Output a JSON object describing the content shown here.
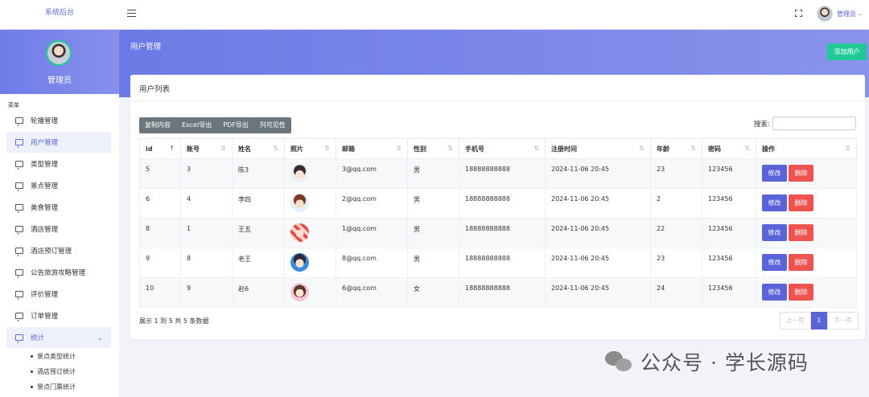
{
  "brand": "系统后台",
  "topbar": {
    "user_name": "管理员",
    "caret": "⌄"
  },
  "sidebar": {
    "user_name": "管理员",
    "menu_caption": "菜单",
    "items": [
      "轮播管理",
      "用户管理",
      "类型管理",
      "景点管理",
      "美食管理",
      "酒店管理",
      "酒店预订管理",
      "公告旅游攻略管理",
      "评价管理",
      "订单管理",
      "统计"
    ],
    "active_index": 1,
    "stats_chevron": "⌄",
    "sub_items": [
      "景点类型统计",
      "酒店预订统计",
      "景点门票统计"
    ]
  },
  "page": {
    "title": "用户管理",
    "add_button": "添加用户"
  },
  "card": {
    "title": "用户列表",
    "tools": [
      "复制内容",
      "Excel导出",
      "PDF导出",
      "列可见性"
    ],
    "search_label": "搜索:",
    "columns": [
      "id",
      "账号",
      "姓名",
      "照片",
      "邮箱",
      "性别",
      "手机号",
      "注册时间",
      "年龄",
      "密码",
      "操作"
    ],
    "rows": [
      {
        "id": "5",
        "account": "3",
        "name": "陈3",
        "email": "3@qq.com",
        "gender": "男",
        "phone": "18888888888",
        "time": "2024-11-06 20:45",
        "age": "23",
        "pwd": "123456"
      },
      {
        "id": "6",
        "account": "4",
        "name": "李四",
        "email": "2@qq.com",
        "gender": "男",
        "phone": "18888888888",
        "time": "2024-11-06 20:45",
        "age": "2",
        "pwd": "123456"
      },
      {
        "id": "8",
        "account": "1",
        "name": "王五",
        "email": "1@qq.com",
        "gender": "男",
        "phone": "18888888888",
        "time": "2024-11-06 20:45",
        "age": "22",
        "pwd": "123456"
      },
      {
        "id": "9",
        "account": "8",
        "name": "老王",
        "email": "8@qq.com",
        "gender": "男",
        "phone": "18888888888",
        "time": "2024-11-06 20:45",
        "age": "23",
        "pwd": "123456"
      },
      {
        "id": "10",
        "account": "9",
        "name": "赵6",
        "email": "6@qq.com",
        "gender": "女",
        "phone": "18888888888",
        "time": "2024-11-06 20:45",
        "age": "24",
        "pwd": "123456"
      }
    ],
    "edit_label": "修改",
    "delete_label": "删除",
    "footer_info": "展示 1 到 5 共 5 条数据",
    "pager": {
      "prev": "上一页",
      "current": "1",
      "next": "下一页"
    }
  },
  "watermark": "公众号 · 学长源码",
  "colors": {
    "accent": "#5b63d9",
    "banner": "#7682e8",
    "success": "#20c997",
    "danger": "#ef5350"
  }
}
